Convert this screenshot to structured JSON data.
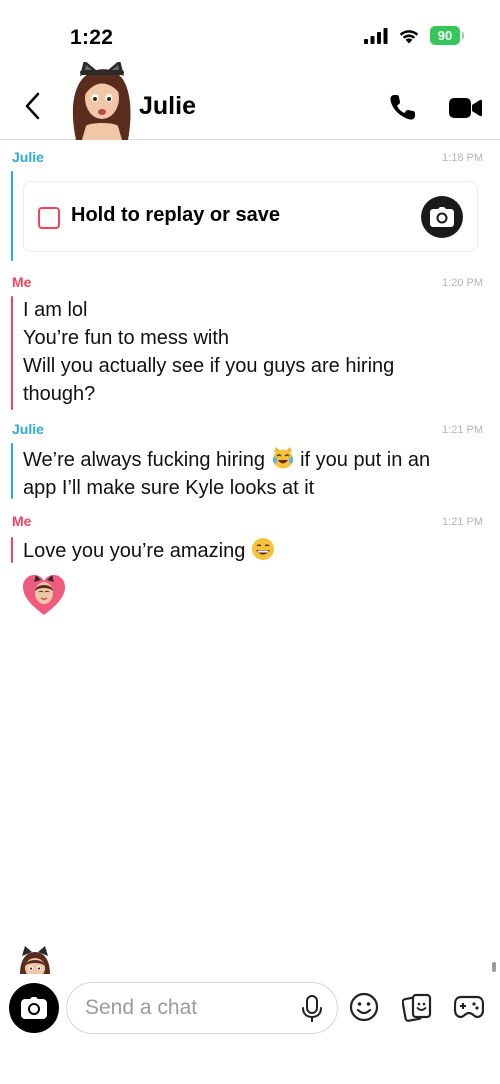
{
  "status_bar": {
    "time": "1:22",
    "battery": "90",
    "icons": [
      "signal-icon",
      "wifi-icon",
      "battery-icon"
    ]
  },
  "header": {
    "contact_name": "Julie",
    "icons": [
      "back-chevron-icon",
      "bitmoji-avatar",
      "phone-icon",
      "video-camera-icon"
    ]
  },
  "messages": [
    {
      "sender": "Julie",
      "time": "1:18 PM",
      "snap_label": "Hold to replay or save"
    },
    {
      "sender": "Me",
      "time": "1:20 PM",
      "lines": [
        "I am lol",
        "You’re fun to mess with",
        "Will you actually see if you guys are hiring",
        "though?"
      ]
    },
    {
      "sender": "Julie",
      "time": "1:21 PM",
      "line1_pre": "We’re always fucking hiring",
      "line1_post": "if you put in an",
      "line2": "app I’ll make sure Kyle looks at it"
    },
    {
      "sender": "Me",
      "time": "1:21 PM",
      "text": "Love you you’re amazing"
    }
  ],
  "composer": {
    "placeholder": "Send a chat",
    "icons": [
      "camera-icon",
      "microphone-icon",
      "smiley-icon",
      "sticker-icon",
      "game-controller-icon"
    ]
  },
  "colors": {
    "julie": "#2ea8e6",
    "me": "#f2455a",
    "battery": "#34c759",
    "timestamp": "#b4b4b4"
  }
}
